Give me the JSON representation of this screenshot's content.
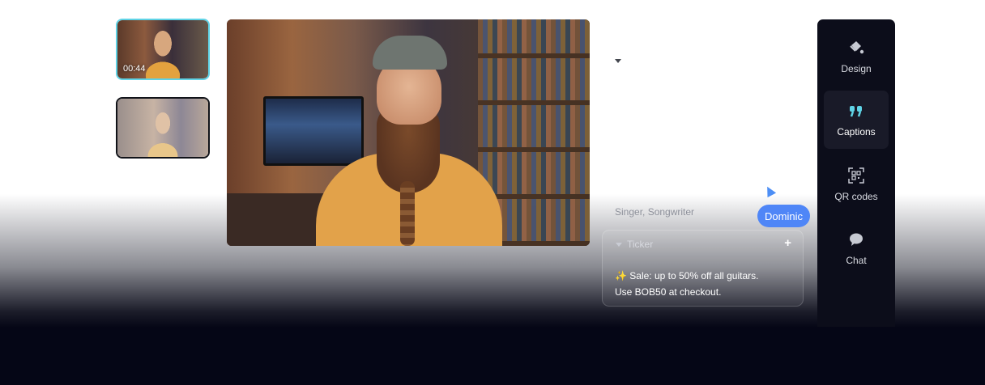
{
  "thumbnails": [
    {
      "time": "00:44"
    },
    {
      "time": ""
    }
  ],
  "panel": {
    "faded_subtitle": "Singer, Songwriter",
    "cursor_label": "Dominic",
    "ticker": {
      "title": "Ticker",
      "add_label": "+",
      "line1": "✨ Sale: up to 50% off all guitars.",
      "line2": "Use BOB50 at checkout."
    }
  },
  "sidebar": {
    "items": [
      {
        "label": "Design",
        "icon": "paint-bucket-icon"
      },
      {
        "label": "Captions",
        "icon": "quote-icon"
      },
      {
        "label": "QR codes",
        "icon": "qr-code-icon"
      },
      {
        "label": "Chat",
        "icon": "chat-bubble-icon"
      }
    ],
    "active_color": "#5fd3e6"
  }
}
